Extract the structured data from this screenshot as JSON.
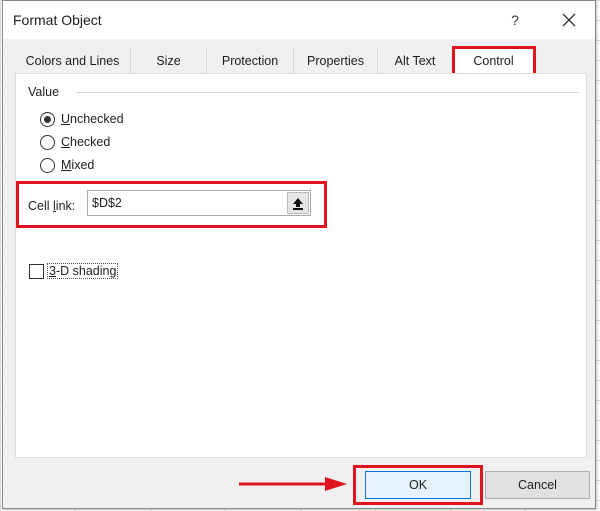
{
  "dialog": {
    "title": "Format Object",
    "help_label": "?",
    "close_icon": "close-icon"
  },
  "tabs": [
    {
      "label": "Colors and Lines",
      "active": false
    },
    {
      "label": "Size",
      "active": false
    },
    {
      "label": "Protection",
      "active": false
    },
    {
      "label": "Properties",
      "active": false
    },
    {
      "label": "Alt Text",
      "active": false
    },
    {
      "label": "Control",
      "active": true
    }
  ],
  "value_group": {
    "label": "Value",
    "options": [
      {
        "mnemonic": "U",
        "rest": "nchecked",
        "checked": true
      },
      {
        "mnemonic": "C",
        "rest": "hecked",
        "checked": false
      },
      {
        "mnemonic": "M",
        "rest": "ixed",
        "checked": false
      }
    ]
  },
  "cell_link": {
    "label_pre": "Cell ",
    "label_mnemonic": "l",
    "label_post": "ink:",
    "value": "$D$2",
    "ref_button_icon": "collapse-dialog-icon"
  },
  "shading": {
    "mnemonic": "3",
    "rest": "-D shading",
    "checked": false
  },
  "buttons": {
    "ok": "OK",
    "cancel": "Cancel"
  },
  "annotation": {
    "highlight_color": "#e0141e"
  }
}
